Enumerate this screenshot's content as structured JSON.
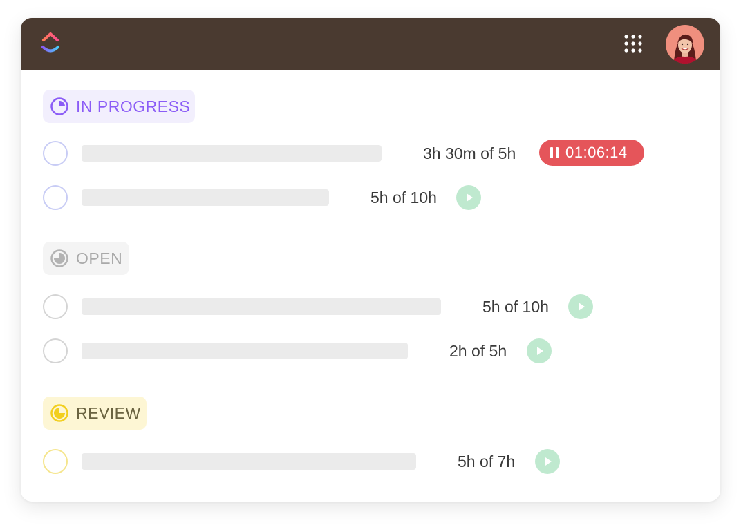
{
  "app": {
    "logo": "clickup-logo-icon",
    "apps_icon": "grid-icon",
    "avatar": "user-avatar",
    "colors": {
      "topbar": "#4a3a30",
      "in_progress": "#8b5cf6",
      "open": "#a9a9a9",
      "review": "#f2cf1f",
      "timer": "#e5555a",
      "play": "#bfe9cf"
    }
  },
  "groups": {
    "in_progress": {
      "label": "IN PROGRESS",
      "tasks": [
        {
          "time": "3h 30m of 5h",
          "timer": "01:06:14",
          "timer_state": "running"
        },
        {
          "time": "5h of 10h"
        }
      ]
    },
    "open": {
      "label": "OPEN",
      "tasks": [
        {
          "time": "5h of 10h"
        },
        {
          "time": "2h of 5h"
        }
      ]
    },
    "review": {
      "label": "REVIEW",
      "tasks": [
        {
          "time": "5h of 7h"
        }
      ]
    }
  }
}
